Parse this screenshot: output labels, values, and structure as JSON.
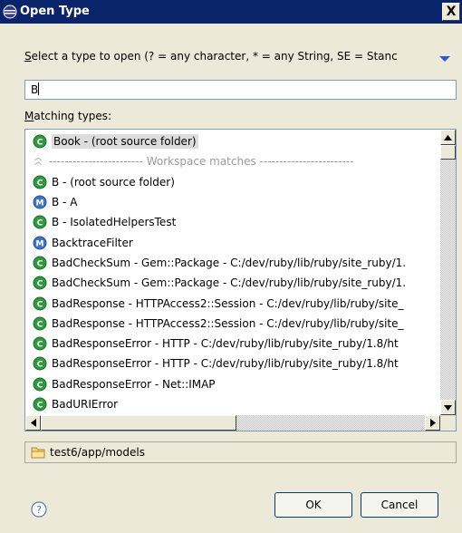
{
  "window": {
    "title": "Open Type",
    "close_label": "X"
  },
  "prompt": {
    "first_letter": "S",
    "rest": "elect a type to open (? = any character, * = any String, SE = Stanc"
  },
  "search": {
    "value": "B"
  },
  "matching": {
    "first_letter": "M",
    "rest": "atching types:"
  },
  "list": {
    "items": [
      {
        "icon": "class-icon",
        "text": "Book - (root source folder)",
        "selected": true
      },
      {
        "icon": "separator-icon",
        "text": "------------------------ Workspace matches ------------------------",
        "separator": true
      },
      {
        "icon": "class-icon",
        "text": "B - (root source folder)"
      },
      {
        "icon": "module-icon",
        "text": "B - A"
      },
      {
        "icon": "class-icon",
        "text": "B - IsolatedHelpersTest"
      },
      {
        "icon": "module-icon",
        "text": "BacktraceFilter"
      },
      {
        "icon": "class-icon",
        "text": "BadCheckSum - Gem::Package - C:/dev/ruby/lib/ruby/site_ruby/1."
      },
      {
        "icon": "class-icon",
        "text": "BadCheckSum - Gem::Package - C:/dev/ruby/lib/ruby/site_ruby/1."
      },
      {
        "icon": "class-icon",
        "text": "BadResponse - HTTPAccess2::Session - C:/dev/ruby/lib/ruby/site_"
      },
      {
        "icon": "class-icon",
        "text": "BadResponse - HTTPAccess2::Session - C:/dev/ruby/lib/ruby/site_"
      },
      {
        "icon": "class-icon",
        "text": "BadResponseError - HTTP - C:/dev/ruby/lib/ruby/site_ruby/1.8/ht"
      },
      {
        "icon": "class-icon",
        "text": "BadResponseError - HTTP - C:/dev/ruby/lib/ruby/site_ruby/1.8/ht"
      },
      {
        "icon": "class-icon",
        "text": "BadResponseError - Net::IMAP"
      },
      {
        "icon": "class-icon",
        "text": "BadURIError"
      }
    ]
  },
  "status": {
    "icon": "folder-icon",
    "path": "test6/app/models"
  },
  "buttons": {
    "ok": "OK",
    "cancel": "Cancel"
  },
  "colors": {
    "class_green": "#2e9a3e",
    "module_blue": "#3f73c8",
    "titlebar": "#0a246a"
  }
}
